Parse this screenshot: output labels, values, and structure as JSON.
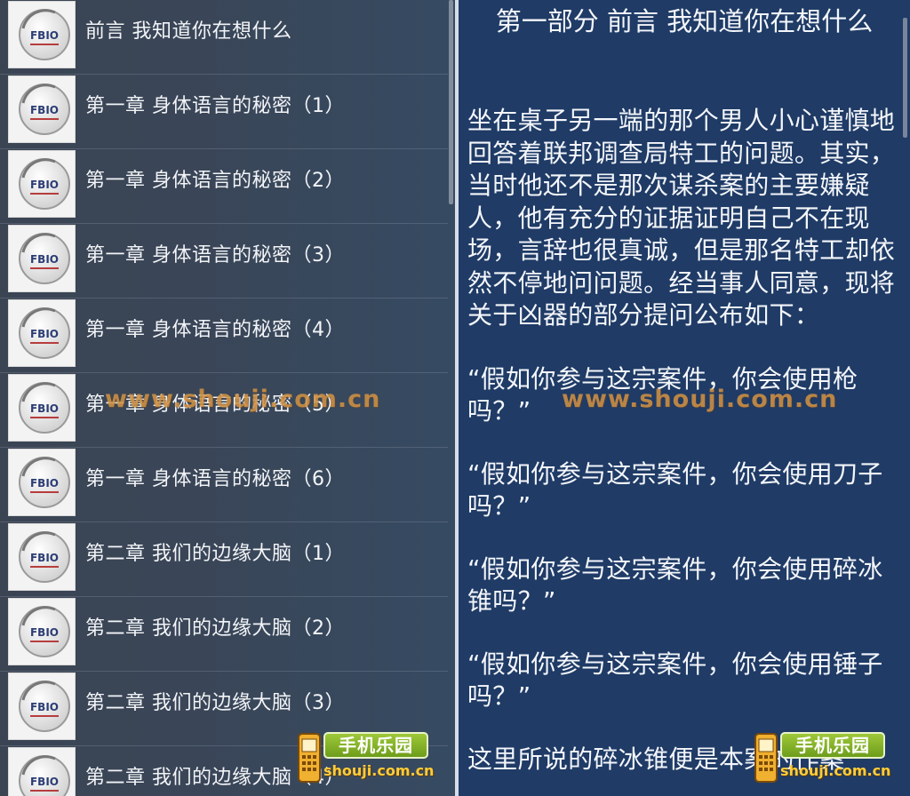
{
  "chapter_list": {
    "thumb_label": "FBIO",
    "items": [
      {
        "title": "前言 我知道你在想什么"
      },
      {
        "title": "第一章 身体语言的秘密（1）"
      },
      {
        "title": "第一章 身体语言的秘密（2）"
      },
      {
        "title": "第一章 身体语言的秘密（3）"
      },
      {
        "title": "第一章 身体语言的秘密（4）"
      },
      {
        "title": "第一章 身体语言的秘密（5）"
      },
      {
        "title": "第一章 身体语言的秘密（6）"
      },
      {
        "title": "第二章 我们的边缘大脑（1）"
      },
      {
        "title": "第二章 我们的边缘大脑（2）"
      },
      {
        "title": "第二章 我们的边缘大脑（3）"
      },
      {
        "title": "第二章 我们的边缘大脑（4）"
      }
    ]
  },
  "reader": {
    "title": "第一部分 前言 我知道你在想什么",
    "paragraphs": [
      "坐在桌子另一端的那个男人小心谨慎地回答着联邦调查局特工的问题。其实，当时他还不是那次谋杀案的主要嫌疑人，他有充分的证据证明自己不在现场，言辞也很真诚，但是那名特工却依然不停地问问题。经当事人同意，现将关于凶器的部分提问公布如下：",
      "“假如你参与这宗案件，你会使用枪吗？”",
      "“假如你参与这宗案件，你会使用刀子吗？”",
      "“假如你参与这宗案件，你会使用碎冰锥吗？”",
      "“假如你参与这宗案件，你会使用锤子吗？”",
      "这里所说的碎冰锥便是本案的作案"
    ]
  },
  "watermarks": {
    "url_text": "www.shouji.com.cn",
    "logo_name": "手机乐园",
    "logo_domain": "shouji.com.cn"
  },
  "colors": {
    "list_background": "#39475a",
    "reader_background": "#1f3b66",
    "text": "#f4f6fa",
    "logo_green": "#8bb52e",
    "watermark_orange": "#d69646"
  },
  "icons": {
    "chapter_thumb": "fbi-badge-icon",
    "logo_phone": "phone-icon"
  }
}
